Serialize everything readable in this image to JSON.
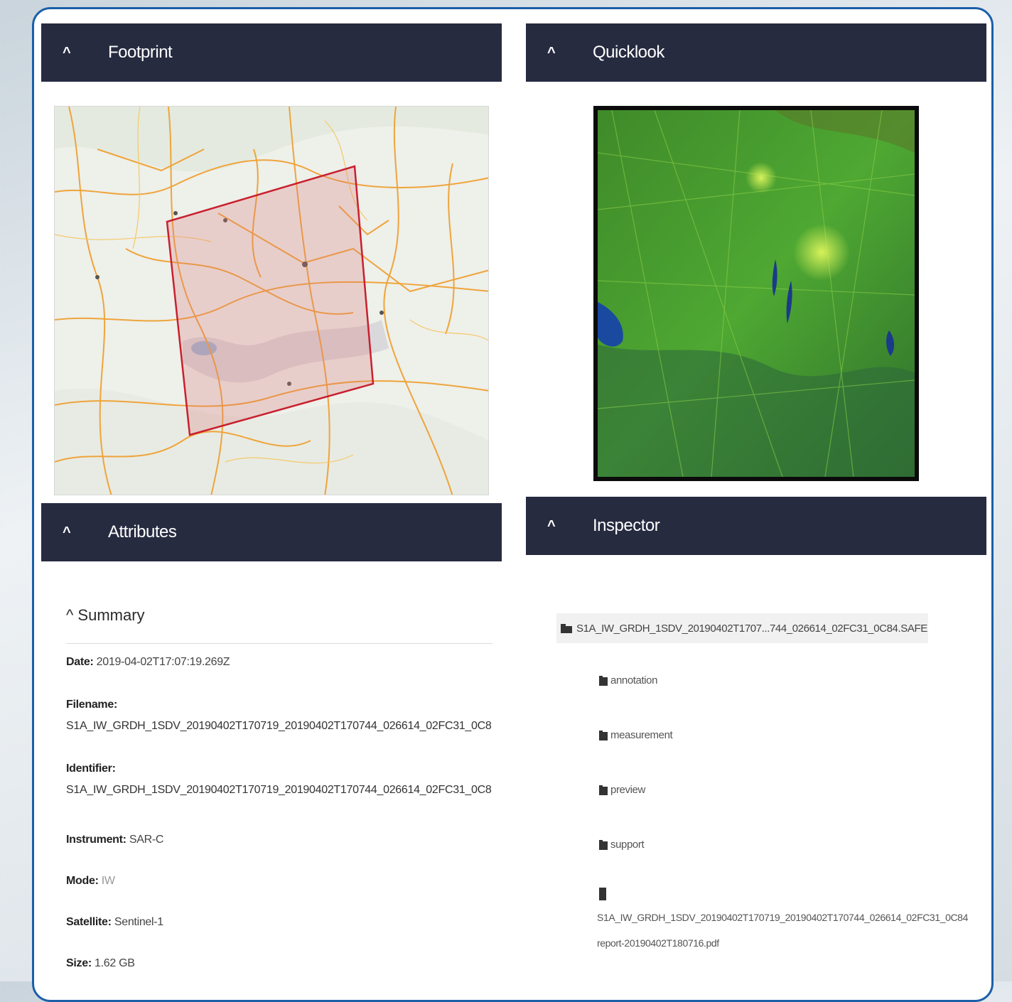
{
  "panels": {
    "footprint": {
      "title": "Footprint",
      "chevron": "^"
    },
    "quicklook": {
      "title": "Quicklook",
      "chevron": "^"
    },
    "attributes": {
      "title": "Attributes",
      "chevron": "^"
    },
    "inspector": {
      "title": "Inspector",
      "chevron": "^"
    }
  },
  "summary": {
    "heading": "^ Summary",
    "date_label": "Date:",
    "date_value": "2019-04-02T17:07:19.269Z",
    "filename_label": "Filename:",
    "filename_value": "S1A_IW_GRDH_1SDV_20190402T170719_20190402T170744_026614_02FC31_0C8",
    "identifier_label": "Identifier:",
    "identifier_value": "S1A_IW_GRDH_1SDV_20190402T170719_20190402T170744_026614_02FC31_0C8",
    "instrument_label": "Instrument:",
    "instrument_value": "SAR-C",
    "mode_label": "Mode:",
    "mode_value": "IW",
    "satellite_label": "Satellite:",
    "satellite_value": "Sentinel-1",
    "size_label": "Size:",
    "size_value": "1.62 GB"
  },
  "inspector": {
    "root": "S1A_IW_GRDH_1SDV_20190402T1707...744_026614_02FC31_0C84.SAFE",
    "folders": [
      "annotation",
      "measurement",
      "preview",
      "support"
    ],
    "file_line1": "S1A_IW_GRDH_1SDV_20190402T170719_20190402T170744_026614_02FC31_0C84",
    "file_line2": "report-20190402T180716.pdf"
  },
  "colors": {
    "header_bg": "#262b40",
    "frame_border": "#1b5fa8",
    "footprint_outline": "#c8202f"
  }
}
